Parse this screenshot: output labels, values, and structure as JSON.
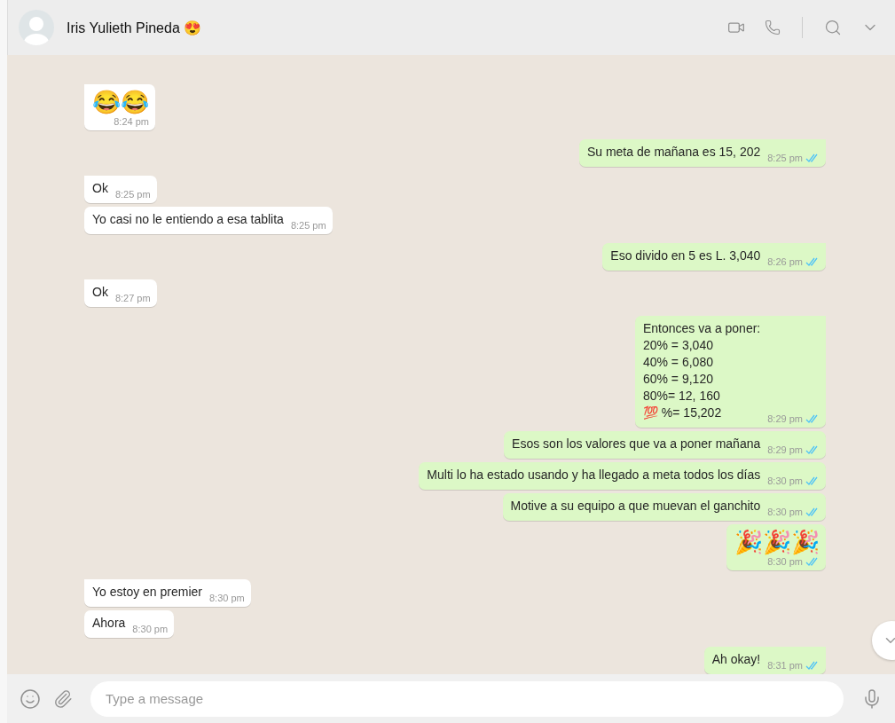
{
  "header": {
    "contact_name": "Iris Yulieth Pineda 😍"
  },
  "messages": [
    {
      "outgoing": false,
      "text": "😂😂",
      "time": "8:24 pm",
      "kind": "emoji"
    },
    {
      "outgoing": true,
      "text": "Su meta de mañana es 15, 202",
      "time": "8:25 pm",
      "read": true,
      "kind": "text"
    },
    {
      "outgoing": false,
      "text": "Ok",
      "time": "8:25 pm",
      "kind": "text"
    },
    {
      "outgoing": false,
      "text": "Yo casi no le entiendo a esa tablita",
      "time": "8:25 pm",
      "kind": "text"
    },
    {
      "outgoing": true,
      "text": "Eso divido en 5 es L. 3,040",
      "time": "8:26 pm",
      "read": true,
      "kind": "text"
    },
    {
      "outgoing": false,
      "text": "Ok",
      "time": "8:27 pm",
      "kind": "text"
    },
    {
      "outgoing": true,
      "text": "Entonces va a poner:\n20% = 3,040\n40% = 6,080\n60% = 9,120\n80%= 12, 160\n💯 %= 15,202",
      "time": "8:29 pm",
      "read": true,
      "kind": "text"
    },
    {
      "outgoing": true,
      "text": "Esos son los valores que va a poner mañana",
      "time": "8:29 pm",
      "read": true,
      "kind": "text"
    },
    {
      "outgoing": true,
      "text": "Multi lo ha estado usando y ha llegado a meta todos los días",
      "time": "8:30 pm",
      "read": true,
      "kind": "text"
    },
    {
      "outgoing": true,
      "text": "Motive a su equipo a que muevan el ganchito",
      "time": "8:30 pm",
      "read": true,
      "kind": "text"
    },
    {
      "outgoing": true,
      "text": "🎉🎉🎉",
      "time": "8:30 pm",
      "read": true,
      "kind": "emoji"
    },
    {
      "outgoing": false,
      "text": "Yo estoy en premier",
      "time": "8:30 pm",
      "kind": "text"
    },
    {
      "outgoing": false,
      "text": "Ahora",
      "time": "8:30 pm",
      "kind": "text"
    },
    {
      "outgoing": true,
      "text": "Ah okay!",
      "time": "8:31 pm",
      "read": true,
      "kind": "text"
    }
  ],
  "composer": {
    "placeholder": "Type a message"
  }
}
